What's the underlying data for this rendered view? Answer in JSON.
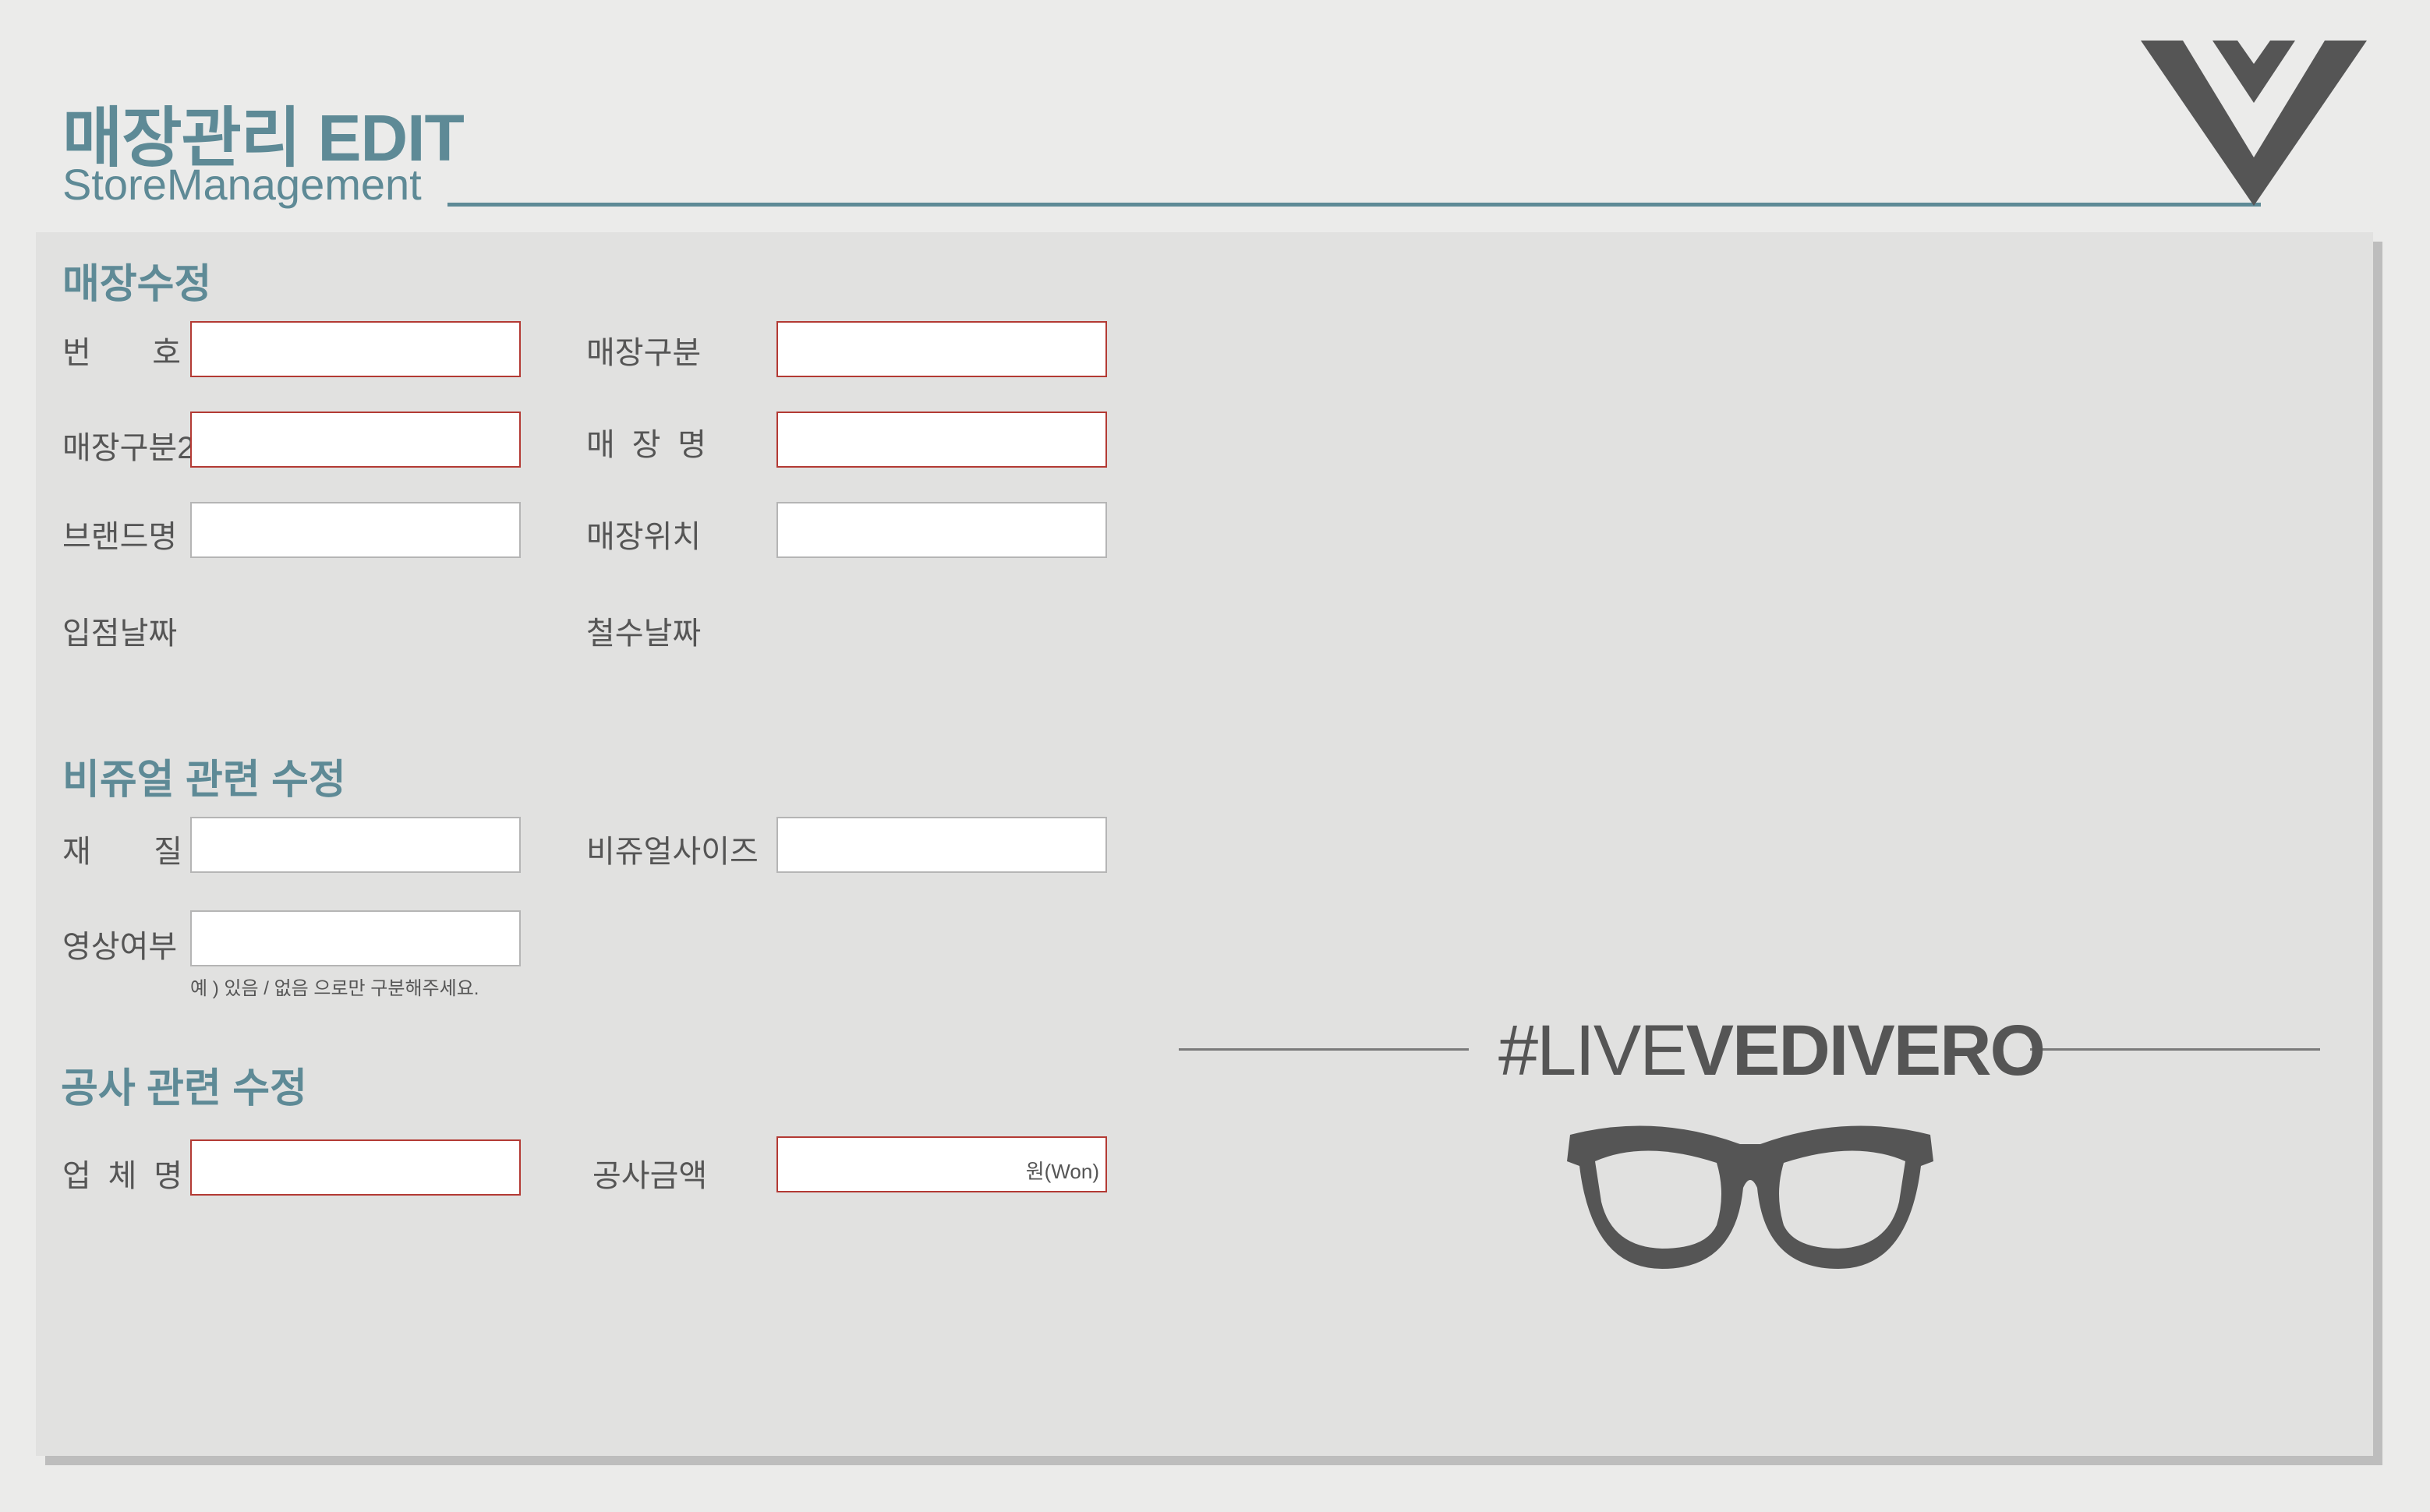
{
  "header": {
    "title": "매장관리 EDIT",
    "subtitle": "StoreManagement"
  },
  "store_edit": {
    "section_title": "매장수정",
    "number_label_chars": [
      "번",
      "호"
    ],
    "store_type_label": "매장구분",
    "store_type2_label": "매장구분2",
    "store_name_label_chars": [
      "매",
      "장",
      "명"
    ],
    "brand_label": "브랜드명",
    "location_label": "매장위치",
    "open_date_label": "입점날짜",
    "close_date_label": "철수날짜",
    "fields": {
      "number": "",
      "store_type": "",
      "store_type2": "",
      "store_name": "",
      "brand": "",
      "location": ""
    }
  },
  "visual_edit": {
    "section_title": "비쥬얼 관련 수정",
    "material_label_chars": [
      "재",
      "질"
    ],
    "visual_size_label": "비쥬얼사이즈",
    "video_label": "영상여부",
    "video_hint": "예 ) 있음 / 없음 으로만 구분해주세요.",
    "fields": {
      "material": "",
      "visual_size": "",
      "video": ""
    }
  },
  "construction_edit": {
    "section_title": "공사 관련 수정",
    "company_label_chars": [
      "업",
      "체",
      "명"
    ],
    "amount_label": "공사금액",
    "amount_unit": "원(Won)",
    "fields": {
      "company": "",
      "amount": ""
    }
  },
  "brand_art": {
    "hashtag_prefix": "#LIVE",
    "hashtag_bold": "VEDIVERO",
    "logo_icon": "vedivero-v-logo-icon",
    "glasses_icon": "eyeglasses-icon"
  },
  "colors": {
    "accent": "#5e8a96",
    "required_border": "#b33a34",
    "panel": "#e1e1e0",
    "background": "#ebebea"
  }
}
